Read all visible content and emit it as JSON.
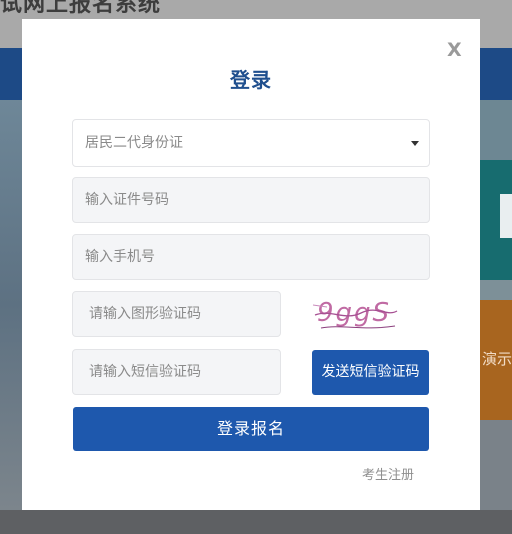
{
  "background": {
    "title": "试网上报名系统",
    "side_text": "演示"
  },
  "modal": {
    "close_label": "X",
    "title": "登录",
    "id_type_select": {
      "selected": "居民二代身份证"
    },
    "id_number": {
      "placeholder": "输入证件号码"
    },
    "phone": {
      "placeholder": "输入手机号"
    },
    "captcha": {
      "placeholder": "请输入图形验证码",
      "image_text": "9ggS"
    },
    "sms_code": {
      "placeholder": "请输入短信验证码"
    },
    "send_sms_label": "发送短信验证码",
    "login_label": "登录报名",
    "register_label": "考生注册"
  },
  "colors": {
    "primary": "#1e58ad",
    "title": "#1f4f8e",
    "captcha_text": "#c06aa3"
  }
}
